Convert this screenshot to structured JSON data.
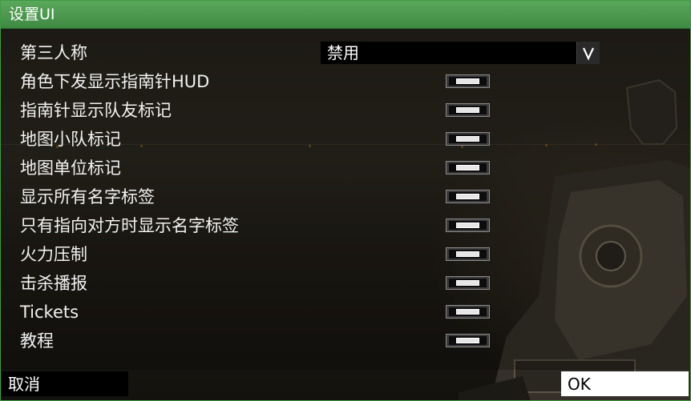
{
  "window": {
    "title": "设置UI"
  },
  "settings": {
    "third_person": {
      "label": "第三人称",
      "value": "禁用"
    },
    "toggles": [
      {
        "label": "角色下发显示指南针HUD"
      },
      {
        "label": "指南针显示队友标记"
      },
      {
        "label": "地图小队标记"
      },
      {
        "label": "地图单位标记"
      },
      {
        "label": "显示所有名字标签"
      },
      {
        "label": "只有指向对方时显示名字标签"
      },
      {
        "label": "火力压制"
      },
      {
        "label": "击杀播报"
      },
      {
        "label": "Tickets"
      },
      {
        "label": "教程"
      }
    ]
  },
  "footer": {
    "cancel_label": "取消",
    "ok_label": "OK"
  },
  "icons": {
    "dropdown": "chevron-down-icon"
  },
  "colors": {
    "titlebar": "#4f9d52",
    "select_bg": "#000000",
    "ok_bg": "#ffffff",
    "cancel_bg": "#000000"
  }
}
